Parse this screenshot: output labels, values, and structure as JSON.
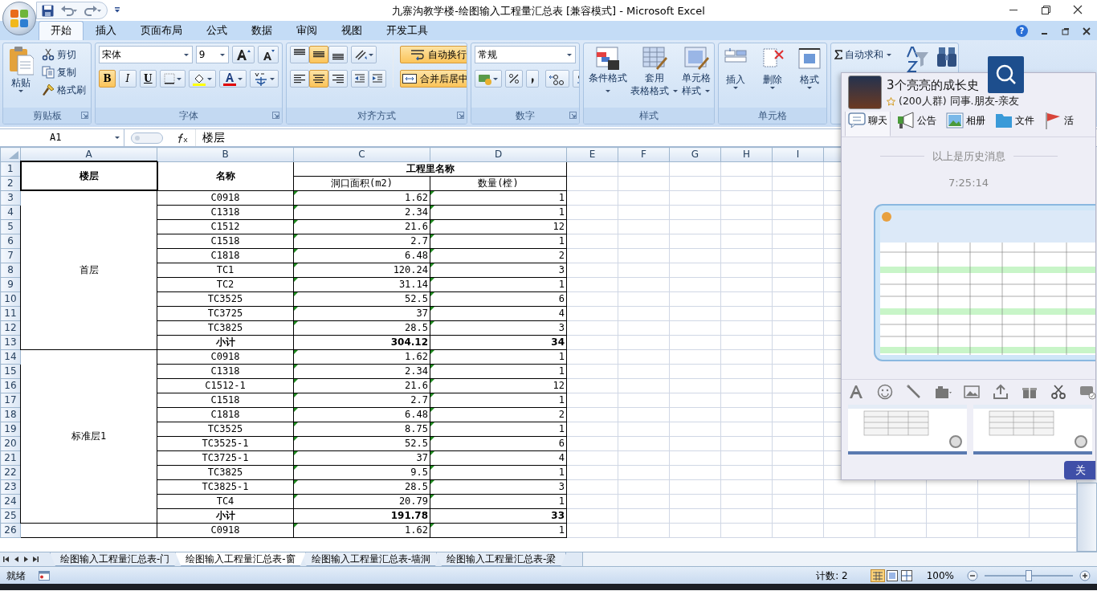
{
  "window": {
    "title": "九寨沟教学楼-绘图输入工程量汇总表  [兼容模式] - Microsoft Excel",
    "help": "?"
  },
  "ribbon": {
    "tabs": [
      {
        "label": "开始",
        "selected": true
      },
      {
        "label": "插入",
        "selected": false
      },
      {
        "label": "页面布局",
        "selected": false
      },
      {
        "label": "公式",
        "selected": false
      },
      {
        "label": "数据",
        "selected": false
      },
      {
        "label": "审阅",
        "selected": false
      },
      {
        "label": "视图",
        "selected": false
      },
      {
        "label": "开发工具",
        "selected": false
      }
    ],
    "groups": [
      {
        "kind": "clipboard",
        "label": "剪贴板",
        "paste": "粘贴",
        "items": [
          "剪切",
          "复制",
          "格式刷"
        ]
      },
      {
        "kind": "font",
        "label": "字体",
        "font_name": "宋体",
        "font_size": "9",
        "format_buttons": [
          {
            "label": "B",
            "on": true
          },
          {
            "label": "I",
            "on": false
          },
          {
            "label": "U",
            "on": false
          }
        ]
      },
      {
        "kind": "alignment",
        "label": "对齐方式",
        "valign": [
          {
            "selected": false
          },
          {
            "selected": true
          },
          {
            "selected": false
          }
        ],
        "halign": [
          {
            "selected": false
          },
          {
            "selected": true
          },
          {
            "selected": false
          }
        ],
        "wrap_text": {
          "label": "自动换行",
          "on": true
        },
        "merge": {
          "label": "合并后居中",
          "on": true
        }
      },
      {
        "kind": "number",
        "label": "数字",
        "format": "常规"
      },
      {
        "kind": "styles",
        "label": "样式",
        "buttons": [
          {
            "lines": [
              "条件格式"
            ]
          },
          {
            "lines": [
              "套用",
              "表格格式"
            ]
          },
          {
            "lines": [
              "单元格",
              "样式"
            ]
          }
        ]
      },
      {
        "kind": "cells",
        "label": "单元格",
        "buttons": [
          "插入",
          "删除",
          "格式"
        ]
      },
      {
        "kind": "editing",
        "autosum": "自动求和"
      }
    ]
  },
  "formula_bar": {
    "name_box": "A1",
    "content": "楼层"
  },
  "sheet": {
    "columns": [
      "A",
      "B",
      "C",
      "D",
      "E",
      "F",
      "G",
      "H",
      "I"
    ],
    "row_numbers": [
      "1",
      "2",
      "3",
      "4",
      "5",
      "6",
      "7",
      "8",
      "9",
      "10",
      "11",
      "12",
      "13",
      "14",
      "15",
      "16",
      "17",
      "18",
      "19",
      "20",
      "21",
      "22",
      "23",
      "24",
      "25",
      "26"
    ],
    "header": {
      "floor": "楼层",
      "name": "名称",
      "group": "工程里名称",
      "area": "洞口面积(m2)",
      "count": "数量(樘)"
    },
    "groups": [
      {
        "floor": "首层",
        "rows": [
          {
            "name": "C0918",
            "area": "1.62",
            "count": "1",
            "flagged": true
          },
          {
            "name": "C1318",
            "area": "2.34",
            "count": "1",
            "flagged": true
          },
          {
            "name": "C1512",
            "area": "21.6",
            "count": "12",
            "flagged": true
          },
          {
            "name": "C1518",
            "area": "2.7",
            "count": "1",
            "flagged": true
          },
          {
            "name": "C1818",
            "area": "6.48",
            "count": "2",
            "flagged": true
          },
          {
            "name": "TC1",
            "area": "120.24",
            "count": "3",
            "flagged": true
          },
          {
            "name": "TC2",
            "area": "31.14",
            "count": "1",
            "flagged": true
          },
          {
            "name": "TC3525",
            "area": "52.5",
            "count": "6",
            "flagged": true
          },
          {
            "name": "TC3725",
            "area": "37",
            "count": "4",
            "flagged": true
          },
          {
            "name": "TC3825",
            "area": "28.5",
            "count": "3",
            "flagged": true
          }
        ],
        "subtotal": {
          "label": "小计",
          "area": "304.12",
          "count": "34"
        }
      },
      {
        "floor": "标准层1",
        "rows": [
          {
            "name": "C0918",
            "area": "1.62",
            "count": "1",
            "flagged": true
          },
          {
            "name": "C1318",
            "area": "2.34",
            "count": "1",
            "flagged": true
          },
          {
            "name": "C1512-1",
            "area": "21.6",
            "count": "12",
            "flagged": true
          },
          {
            "name": "C1518",
            "area": "2.7",
            "count": "1",
            "flagged": true
          },
          {
            "name": "C1818",
            "area": "6.48",
            "count": "2",
            "flagged": true
          },
          {
            "name": "TC3525",
            "area": "8.75",
            "count": "1",
            "flagged": true
          },
          {
            "name": "TC3525-1",
            "area": "52.5",
            "count": "6",
            "flagged": true
          },
          {
            "name": "TC3725-1",
            "area": "37",
            "count": "4",
            "flagged": true
          },
          {
            "name": "TC3825",
            "area": "9.5",
            "count": "1",
            "flagged": true
          },
          {
            "name": "TC3825-1",
            "area": "28.5",
            "count": "3",
            "flagged": true
          },
          {
            "name": "TC4",
            "area": "20.79",
            "count": "1",
            "flagged": true
          }
        ],
        "subtotal": {
          "label": "小计",
          "area": "191.78",
          "count": "33"
        }
      },
      {
        "rows": [
          {
            "name": "C0918",
            "area": "1.62",
            "count": "1",
            "flagged": true
          }
        ]
      }
    ]
  },
  "sheet_tabs": [
    {
      "label": "绘图输入工程量汇总表-门",
      "selected": false
    },
    {
      "label": "绘图输入工程量汇总表-窗",
      "selected": true
    },
    {
      "label": "绘图输入工程量汇总表-墙洞",
      "selected": false
    },
    {
      "label": "绘图输入工程量汇总表-梁",
      "selected": false
    }
  ],
  "status_bar": {
    "status": "就绪",
    "count": "计数: 2",
    "zoom": "100%",
    "zoom_slider": {
      "level": 0.5
    }
  },
  "chat_panel": {
    "group_name": "3个亮亮的成长史",
    "group_info": "(200人群) 同事.朋友-亲友",
    "tabs": [
      {
        "label": "聊天",
        "selected": true
      },
      {
        "label": "公告",
        "selected": false
      },
      {
        "label": "相册",
        "selected": false
      },
      {
        "label": "文件",
        "selected": false
      },
      {
        "label": "活",
        "selected": false
      }
    ],
    "history_note": "以上是历史消息",
    "timestamp": "7:25:14",
    "close_button": "关"
  }
}
